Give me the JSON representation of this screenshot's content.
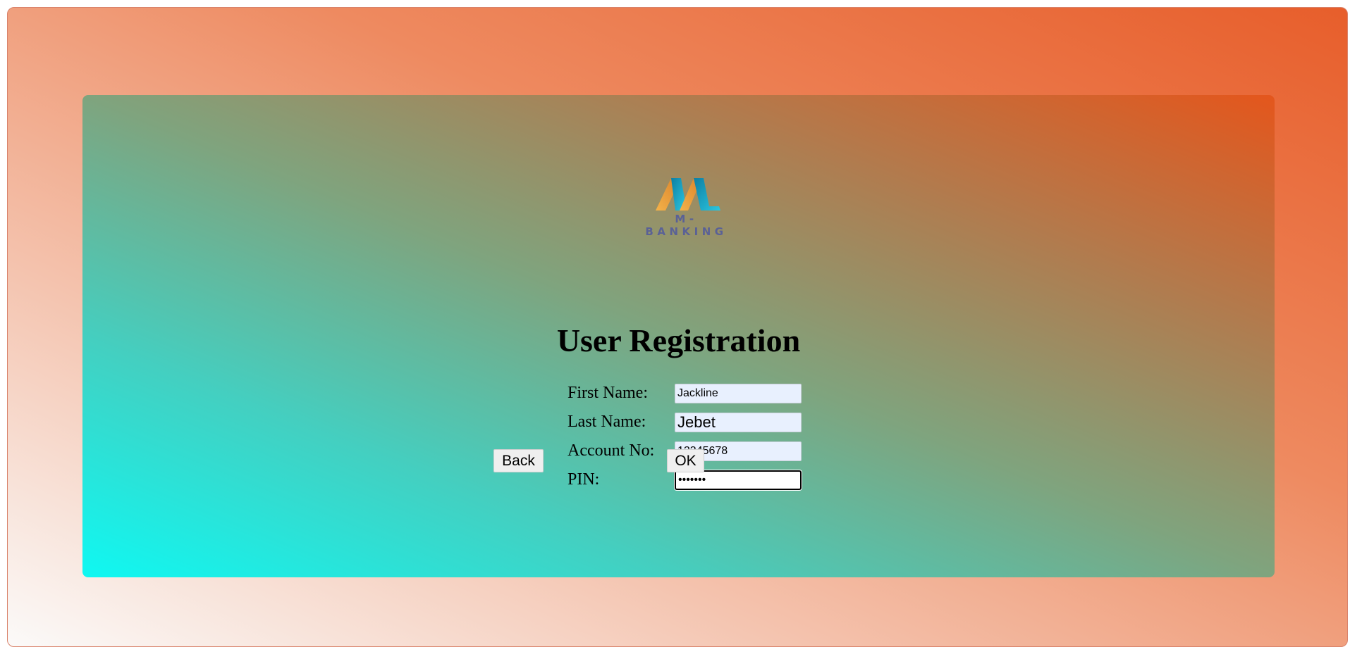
{
  "logo": {
    "text": "M-BANKING",
    "icon": "m-banking-logo-icon",
    "colors": {
      "orange": "#f0a33c",
      "teal": "#1aa9c5",
      "text": "#5a6196"
    }
  },
  "page": {
    "title": "User Registration"
  },
  "form": {
    "first_name": {
      "label": "First Name:",
      "value": "Jackline"
    },
    "last_name": {
      "label": "Last Name:",
      "value": "Jebet"
    },
    "account_no": {
      "label": "Account No:",
      "value": "12345678"
    },
    "pin": {
      "label": "PIN:",
      "value": "1234567"
    }
  },
  "buttons": {
    "back_label": "Back",
    "ok_label": "OK"
  },
  "colors": {
    "outer_gradient": [
      "#fbfaf9",
      "#f4c3ae",
      "#ee8a60",
      "#e75e2b"
    ],
    "card_gradient": [
      "#0ff8f2",
      "#44cfc0",
      "#7fa47e",
      "#b07c4f",
      "#e4561c"
    ],
    "input_autofill": "#e8f0fe"
  }
}
